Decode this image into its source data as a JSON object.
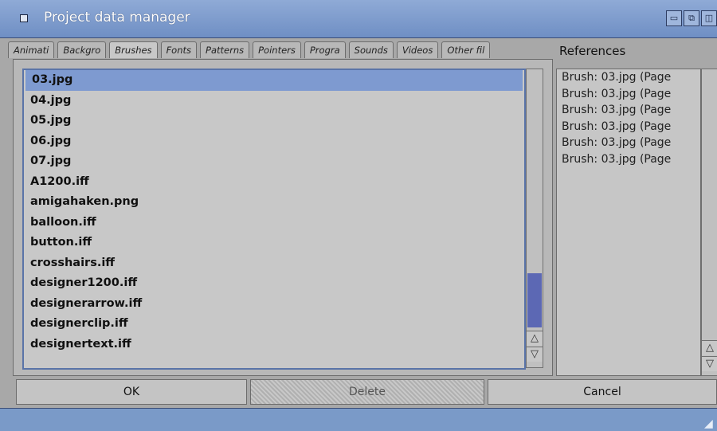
{
  "window": {
    "title": "Project data manager"
  },
  "tabs": [
    {
      "label": "Animati",
      "active": false
    },
    {
      "label": "Backgro",
      "active": false
    },
    {
      "label": "Brushes",
      "active": true
    },
    {
      "label": "Fonts",
      "active": false
    },
    {
      "label": "Patterns",
      "active": false
    },
    {
      "label": "Pointers",
      "active": false
    },
    {
      "label": "Progra",
      "active": false
    },
    {
      "label": "Sounds",
      "active": false
    },
    {
      "label": "Videos",
      "active": false
    },
    {
      "label": "Other fil",
      "active": false
    }
  ],
  "references": {
    "label": "References",
    "items": [
      "Brush: 03.jpg (Page",
      "Brush: 03.jpg (Page",
      "Brush: 03.jpg (Page",
      "Brush: 03.jpg (Page",
      "Brush: 03.jpg (Page",
      "Brush: 03.jpg (Page"
    ]
  },
  "file_list": {
    "selected_index": 0,
    "items": [
      "03.jpg",
      "04.jpg",
      "05.jpg",
      "06.jpg",
      "07.jpg",
      "A1200.iff",
      "amigahaken.png",
      "balloon.iff",
      "button.iff",
      "crosshairs.iff",
      "designer1200.iff",
      "designerarrow.iff",
      "designerclip.iff",
      "designertext.iff"
    ],
    "scroll_up_icon": "▲",
    "scroll_down_icon": "▼"
  },
  "buttons": {
    "ok": "OK",
    "delete": "Delete",
    "cancel": "Cancel"
  },
  "icons": {
    "up": "△",
    "down": "▽",
    "zoom": "⧉",
    "depth": "◫",
    "iconify": "▭"
  }
}
